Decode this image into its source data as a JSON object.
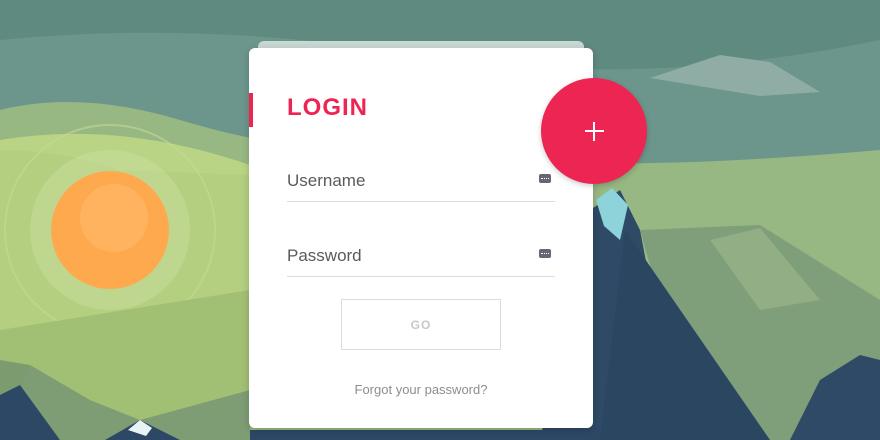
{
  "login": {
    "title": "LOGIN",
    "username_placeholder": "Username",
    "password_placeholder": "Password",
    "go_label": "GO",
    "forgot_label": "Forgot your password?"
  },
  "fab": {
    "icon": "plus-icon"
  },
  "colors": {
    "accent": "#ed2553",
    "card": "#ffffff",
    "sun": "#ffaa52",
    "mountain_dark": "#2e4a66",
    "hill_green": "#b9d384"
  }
}
